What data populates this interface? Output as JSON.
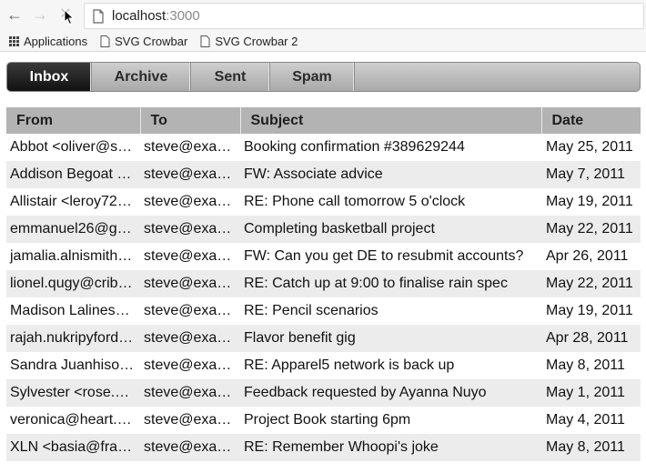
{
  "browser": {
    "url_host": "localhost",
    "url_port": ":3000",
    "bookmarks": [
      {
        "label": "Applications",
        "icon": "apps-grid-icon"
      },
      {
        "label": "SVG Crowbar",
        "icon": "page-icon"
      },
      {
        "label": "SVG Crowbar 2",
        "icon": "page-icon"
      }
    ]
  },
  "tabs": [
    {
      "label": "Inbox",
      "active": true
    },
    {
      "label": "Archive",
      "active": false
    },
    {
      "label": "Sent",
      "active": false
    },
    {
      "label": "Spam",
      "active": false
    }
  ],
  "table": {
    "headers": [
      "From",
      "To",
      "Subject",
      "Date"
    ],
    "rows": [
      [
        "Abbot <oliver@s…",
        "steve@exa…",
        "Booking confirmation #389629244",
        "May 25, 2011"
      ],
      [
        "Addison Begoat …",
        "steve@exa…",
        "FW: Associate advice",
        "May 7, 2011"
      ],
      [
        "Allistair <leroy72…",
        "steve@exa…",
        "RE: Phone call tomorrow 5 o'clock",
        "May 19, 2011"
      ],
      [
        "emmanuel26@g…",
        "steve@exa…",
        "Completing basketball project",
        "May 22, 2011"
      ],
      [
        "jamalia.alnismith…",
        "steve@exa…",
        "FW: Can you get DE to resubmit accounts?",
        "Apr 26, 2011"
      ],
      [
        "lionel.qugy@crib…",
        "steve@exa…",
        "RE: Catch up at 9:00 to finalise rain spec",
        "May 22, 2011"
      ],
      [
        "Madison Lalines…",
        "steve@exa…",
        "RE: Pencil scenarios",
        "May 19, 2011"
      ],
      [
        "rajah.nukripyford…",
        "steve@exa…",
        "Flavor benefit gig",
        "Apr 28, 2011"
      ],
      [
        "Sandra Juanhiso…",
        "steve@exa…",
        "RE: Apparel5 network is back up",
        "May 8, 2011"
      ],
      [
        "Sylvester <rose.…",
        "steve@exa…",
        "Feedback requested by Ayanna Nuyo",
        "May 1, 2011"
      ],
      [
        "veronica@heart.…",
        "steve@exa…",
        "Project Book starting 6pm",
        "May 4, 2011"
      ],
      [
        "XLN <basia@fra…",
        "steve@exa…",
        "RE: Remember Whoopi's joke",
        "May 8, 2011"
      ]
    ]
  }
}
